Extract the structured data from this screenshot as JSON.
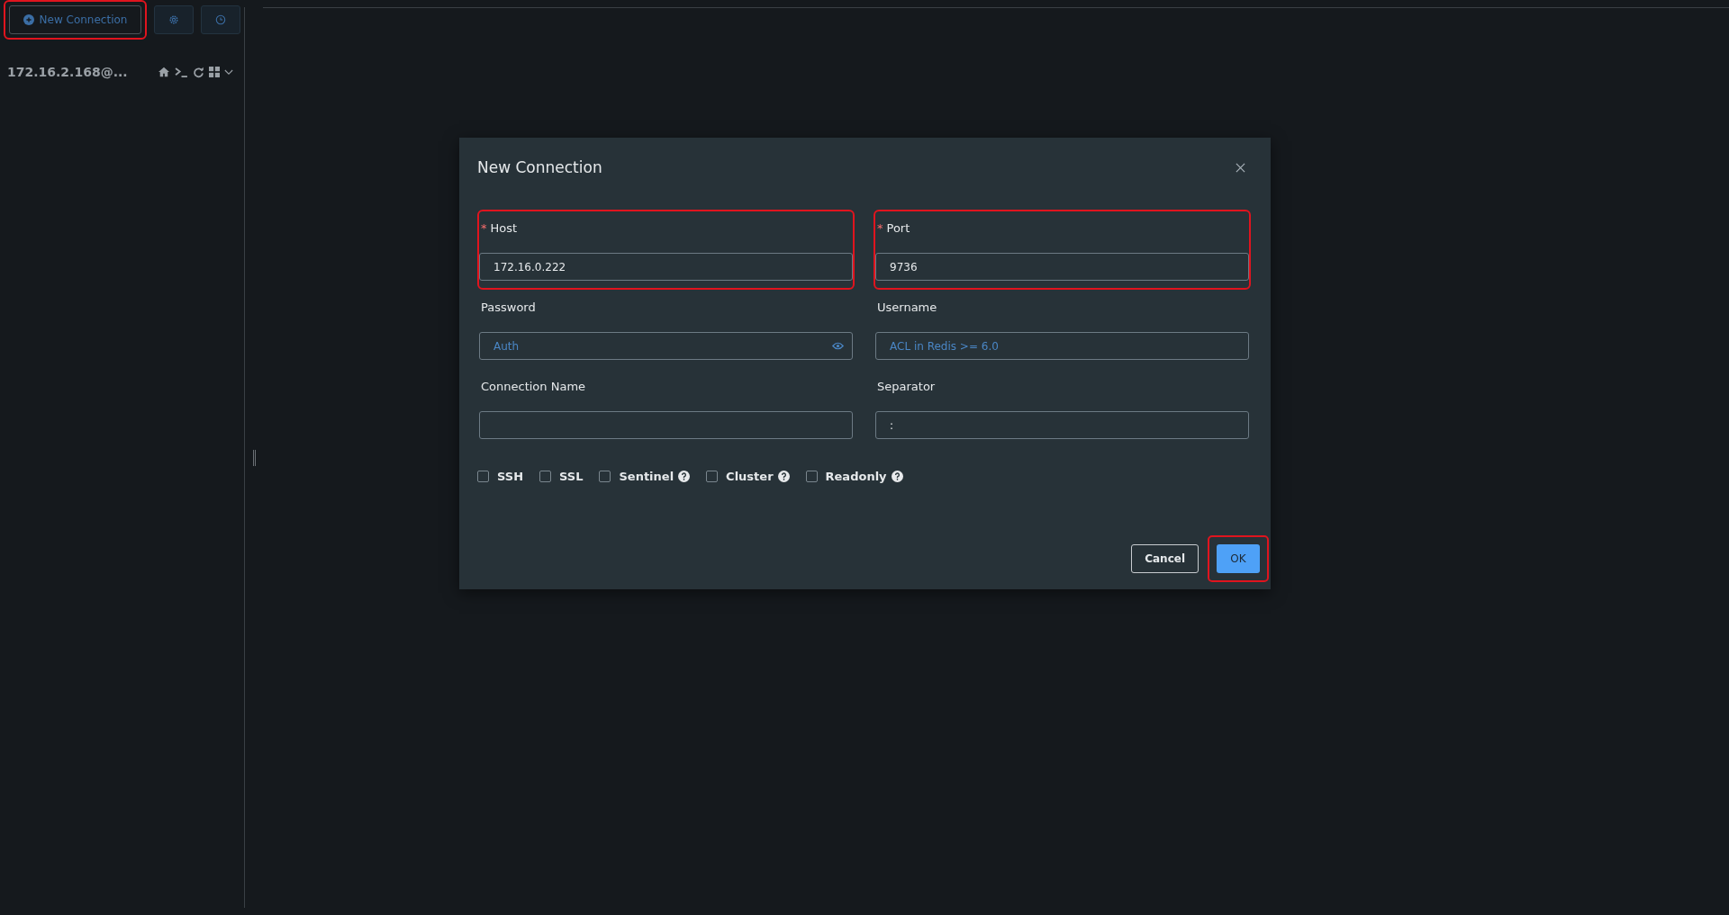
{
  "sidebar": {
    "new_button": {
      "label": "New Connection",
      "highlighted": true
    },
    "connections": [
      {
        "name": "172.16.2.168@..."
      }
    ]
  },
  "dialog": {
    "title": "New Connection",
    "fields": [
      {
        "label": "Host",
        "required_mark": "*",
        "value": "172.16.0.222",
        "highlighted": true
      },
      {
        "label": "Port",
        "required_mark": "*",
        "value": "9736",
        "highlighted": true
      },
      {
        "label": "Password",
        "placeholder": "Auth",
        "kind": "password",
        "highlighted": false
      },
      {
        "label": "Username",
        "placeholder": "ACL in Redis >= 6.0",
        "highlighted": false
      },
      {
        "label": "Connection Name",
        "highlighted": false
      },
      {
        "label": "Separator",
        "value": ":",
        "highlighted": false
      }
    ],
    "options": [
      {
        "label": "SSH",
        "checked": false,
        "help": false
      },
      {
        "label": "SSL",
        "checked": false,
        "help": false
      },
      {
        "label": "Sentinel",
        "checked": false,
        "help": true
      },
      {
        "label": "Cluster",
        "checked": false,
        "help": true
      },
      {
        "label": "Readonly",
        "checked": false,
        "help": true
      }
    ],
    "cancel": {
      "label": "Cancel",
      "highlighted": false
    },
    "ok": {
      "label": "OK",
      "highlighted": true
    }
  }
}
